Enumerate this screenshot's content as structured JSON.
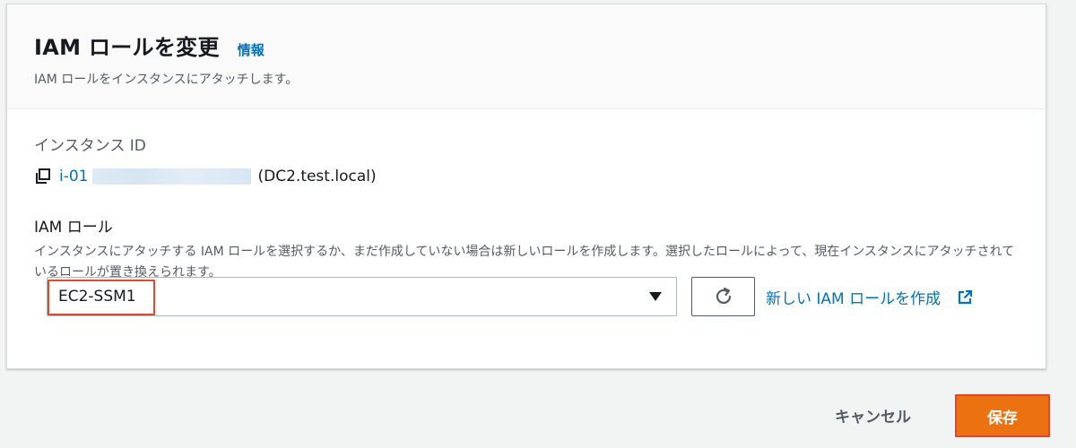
{
  "header": {
    "title": "IAM ロールを変更",
    "info_link": "情報",
    "description": "IAM ロールをインスタンスにアタッチします。"
  },
  "instance": {
    "label": "インスタンス ID",
    "id_prefix": "i-01",
    "name": "(DC2.test.local)"
  },
  "iam_role": {
    "label": "IAM ロール",
    "description": "インスタンスにアタッチする IAM ロールを選択するか、まだ作成していない場合は新しいロールを作成します。選択したロールによって、現在インスタンスにアタッチされているロールが置き換えられます。",
    "selected": "EC2-SSM1",
    "create_link": "新しい IAM ロールを作成"
  },
  "footer": {
    "cancel_label": "キャンセル",
    "save_label": "保存"
  },
  "colors": {
    "link": "#0073bb",
    "primary_button": "#ec7211",
    "highlight": "#e2462b"
  },
  "icons": [
    "copy-icon",
    "caret-down-icon",
    "refresh-icon",
    "external-link-icon"
  ]
}
